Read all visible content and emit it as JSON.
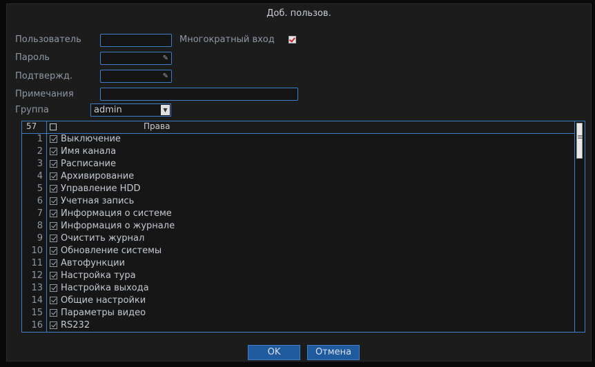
{
  "dialog": {
    "title": "Доб. пользов."
  },
  "form": {
    "user_label": "Пользователь",
    "user_value": "",
    "multi_login_label": "Многократный вход",
    "password_label": "Пароль",
    "confirm_label": "Подтвержд.",
    "notes_label": "Примечания",
    "notes_value": "",
    "group_label": "Группа",
    "group_value": "admin"
  },
  "permissions": {
    "count": "57",
    "header": "Права",
    "items": [
      {
        "num": "1",
        "label": "Выключение"
      },
      {
        "num": "2",
        "label": "Имя канала"
      },
      {
        "num": "3",
        "label": "Расписание"
      },
      {
        "num": "4",
        "label": "Архивирование"
      },
      {
        "num": "5",
        "label": "Управление HDD"
      },
      {
        "num": "6",
        "label": "Учетная запись"
      },
      {
        "num": "7",
        "label": "Информация о системе"
      },
      {
        "num": "8",
        "label": "Информация о журнале"
      },
      {
        "num": "9",
        "label": "Очистить журнал"
      },
      {
        "num": "10",
        "label": "Обновление системы"
      },
      {
        "num": "11",
        "label": "Автофункции"
      },
      {
        "num": "12",
        "label": "Настройка тура"
      },
      {
        "num": "13",
        "label": "Настройка выхода"
      },
      {
        "num": "14",
        "label": "Общие настройки"
      },
      {
        "num": "15",
        "label": "Параметры видео"
      },
      {
        "num": "16",
        "label": "RS232"
      }
    ]
  },
  "buttons": {
    "ok": "OK",
    "cancel": "Отмена"
  },
  "icons": {
    "password_toggle": "password-visibility-icon",
    "dropdown": "chevron-down-icon",
    "scroll": "scroll-thumb-icon"
  },
  "colors": {
    "accent": "#3d7fc8",
    "background": "#1c1c1c",
    "button": "#1f5b9e"
  }
}
